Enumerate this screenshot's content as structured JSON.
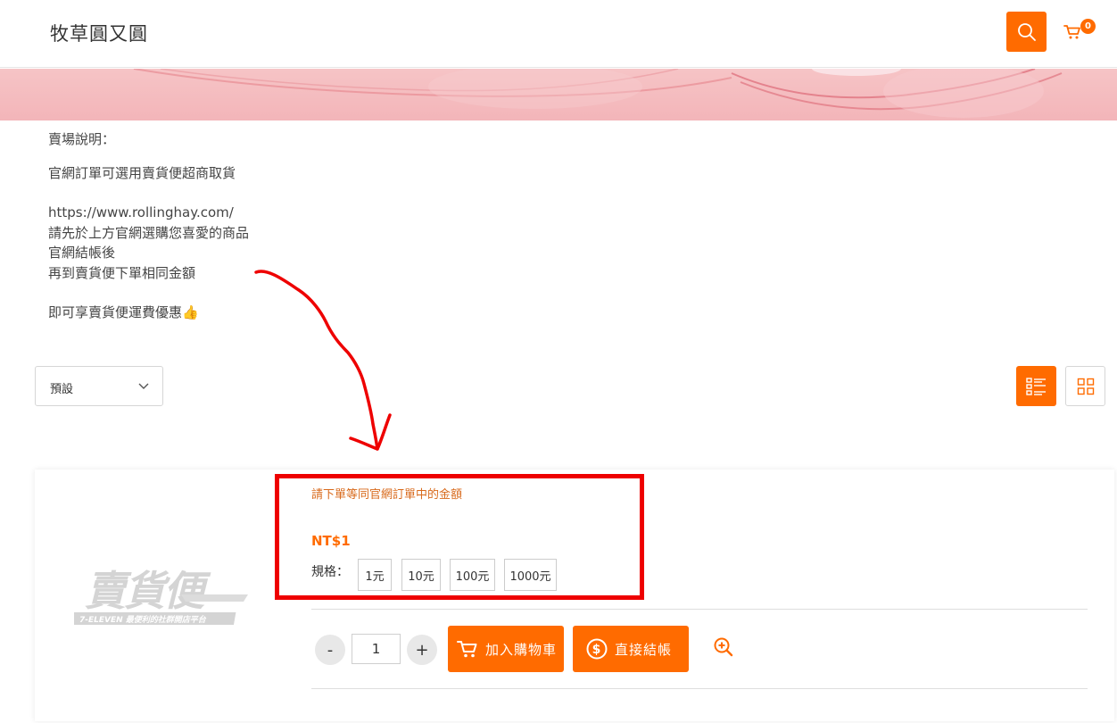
{
  "header": {
    "store_title": "牧草圓又圓",
    "cart_count": "0"
  },
  "description": {
    "lines": [
      "賣場說明：",
      "",
      "官網訂單可選用賣貨便超商取貨",
      "",
      "https://www.rollinghay.com/",
      "請先於上方官網選購您喜愛的商品",
      "官網結帳後",
      "再到賣貨便下單相同金額",
      "",
      "即可享賣貨便運費優惠👍"
    ]
  },
  "toolbar": {
    "sort_selected": "預設"
  },
  "product": {
    "name": "請下單等同官網訂單中的金額",
    "price": "NT$1",
    "spec_label": "規格：",
    "spec_options": [
      "1元",
      "10元",
      "100元",
      "1000元"
    ],
    "quantity": "1",
    "qty_minus": "-",
    "qty_plus": "+",
    "add_to_cart_label": "加入購物車",
    "checkout_label": "直接結帳",
    "logo_text": "賣貨便",
    "logo_subtext": "7-ELEVEN 最便利的社群開店平台"
  },
  "colors": {
    "accent": "#ff6b00",
    "annotation_red": "#ee0000",
    "banner_pink": "#f3b5b9"
  },
  "icons": [
    "search-icon",
    "cart-icon",
    "chevron-down-icon",
    "list-view-icon",
    "grid-view-icon",
    "cart-icon",
    "dollar-icon",
    "zoom-in-icon"
  ]
}
